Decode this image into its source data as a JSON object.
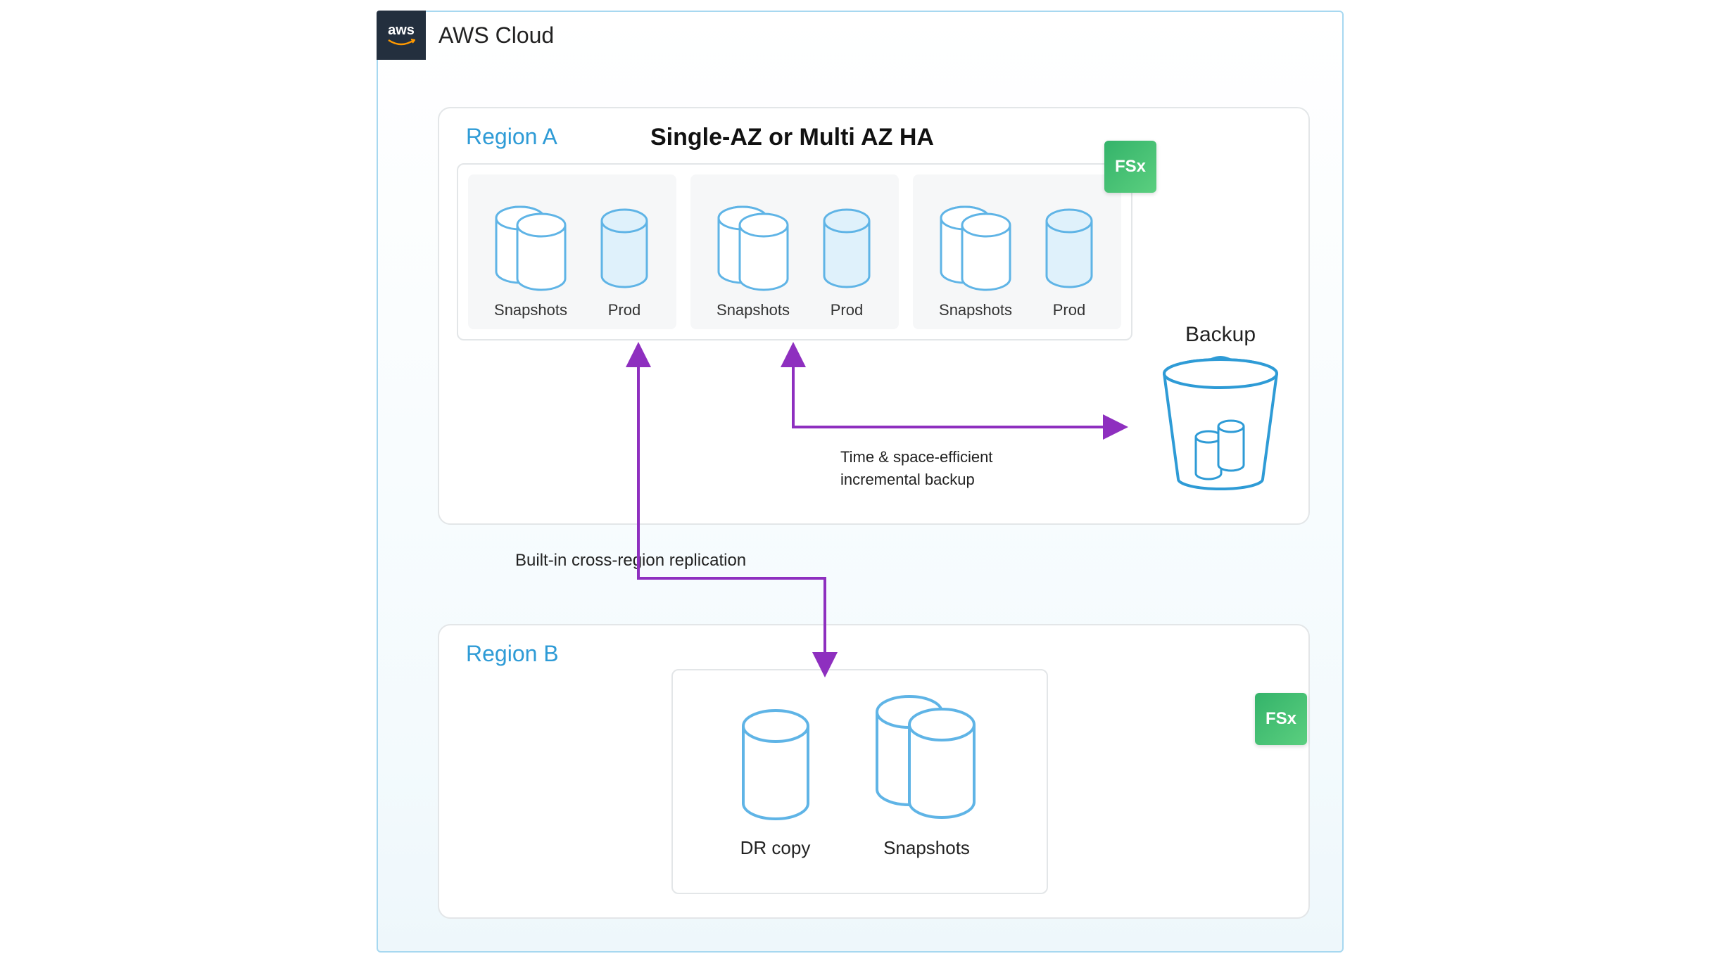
{
  "cloud": {
    "badge_text": "aws",
    "title": "AWS Cloud"
  },
  "regionA": {
    "label": "Region A",
    "ha_title": "Single-AZ or Multi AZ HA",
    "fsx_badge": "FSx",
    "groups": [
      {
        "snapshots": "Snapshots",
        "prod": "Prod"
      },
      {
        "snapshots": "Snapshots",
        "prod": "Prod"
      },
      {
        "snapshots": "Snapshots",
        "prod": "Prod"
      }
    ],
    "backup_label": "Backup",
    "backup_note_line1": "Time & space-efficient",
    "backup_note_line2": "incremental backup"
  },
  "replication_note": "Built-in cross-region replication",
  "regionB": {
    "label": "Region B",
    "fsx_badge": "FSx",
    "dr_copy": "DR copy",
    "snapshots": "Snapshots"
  },
  "colors": {
    "cloud_border": "#a7d8f0",
    "region_border": "#e3e6e8",
    "accent_blue": "#2e9bd6",
    "cylinder_stroke": "#5fb4e6",
    "cylinder_fill_light": "#ffffff",
    "cylinder_fill_tint": "#dff1fb",
    "arrow": "#8e2fbf",
    "fsx_green": "#3fc173",
    "aws_bg": "#232f3e"
  }
}
